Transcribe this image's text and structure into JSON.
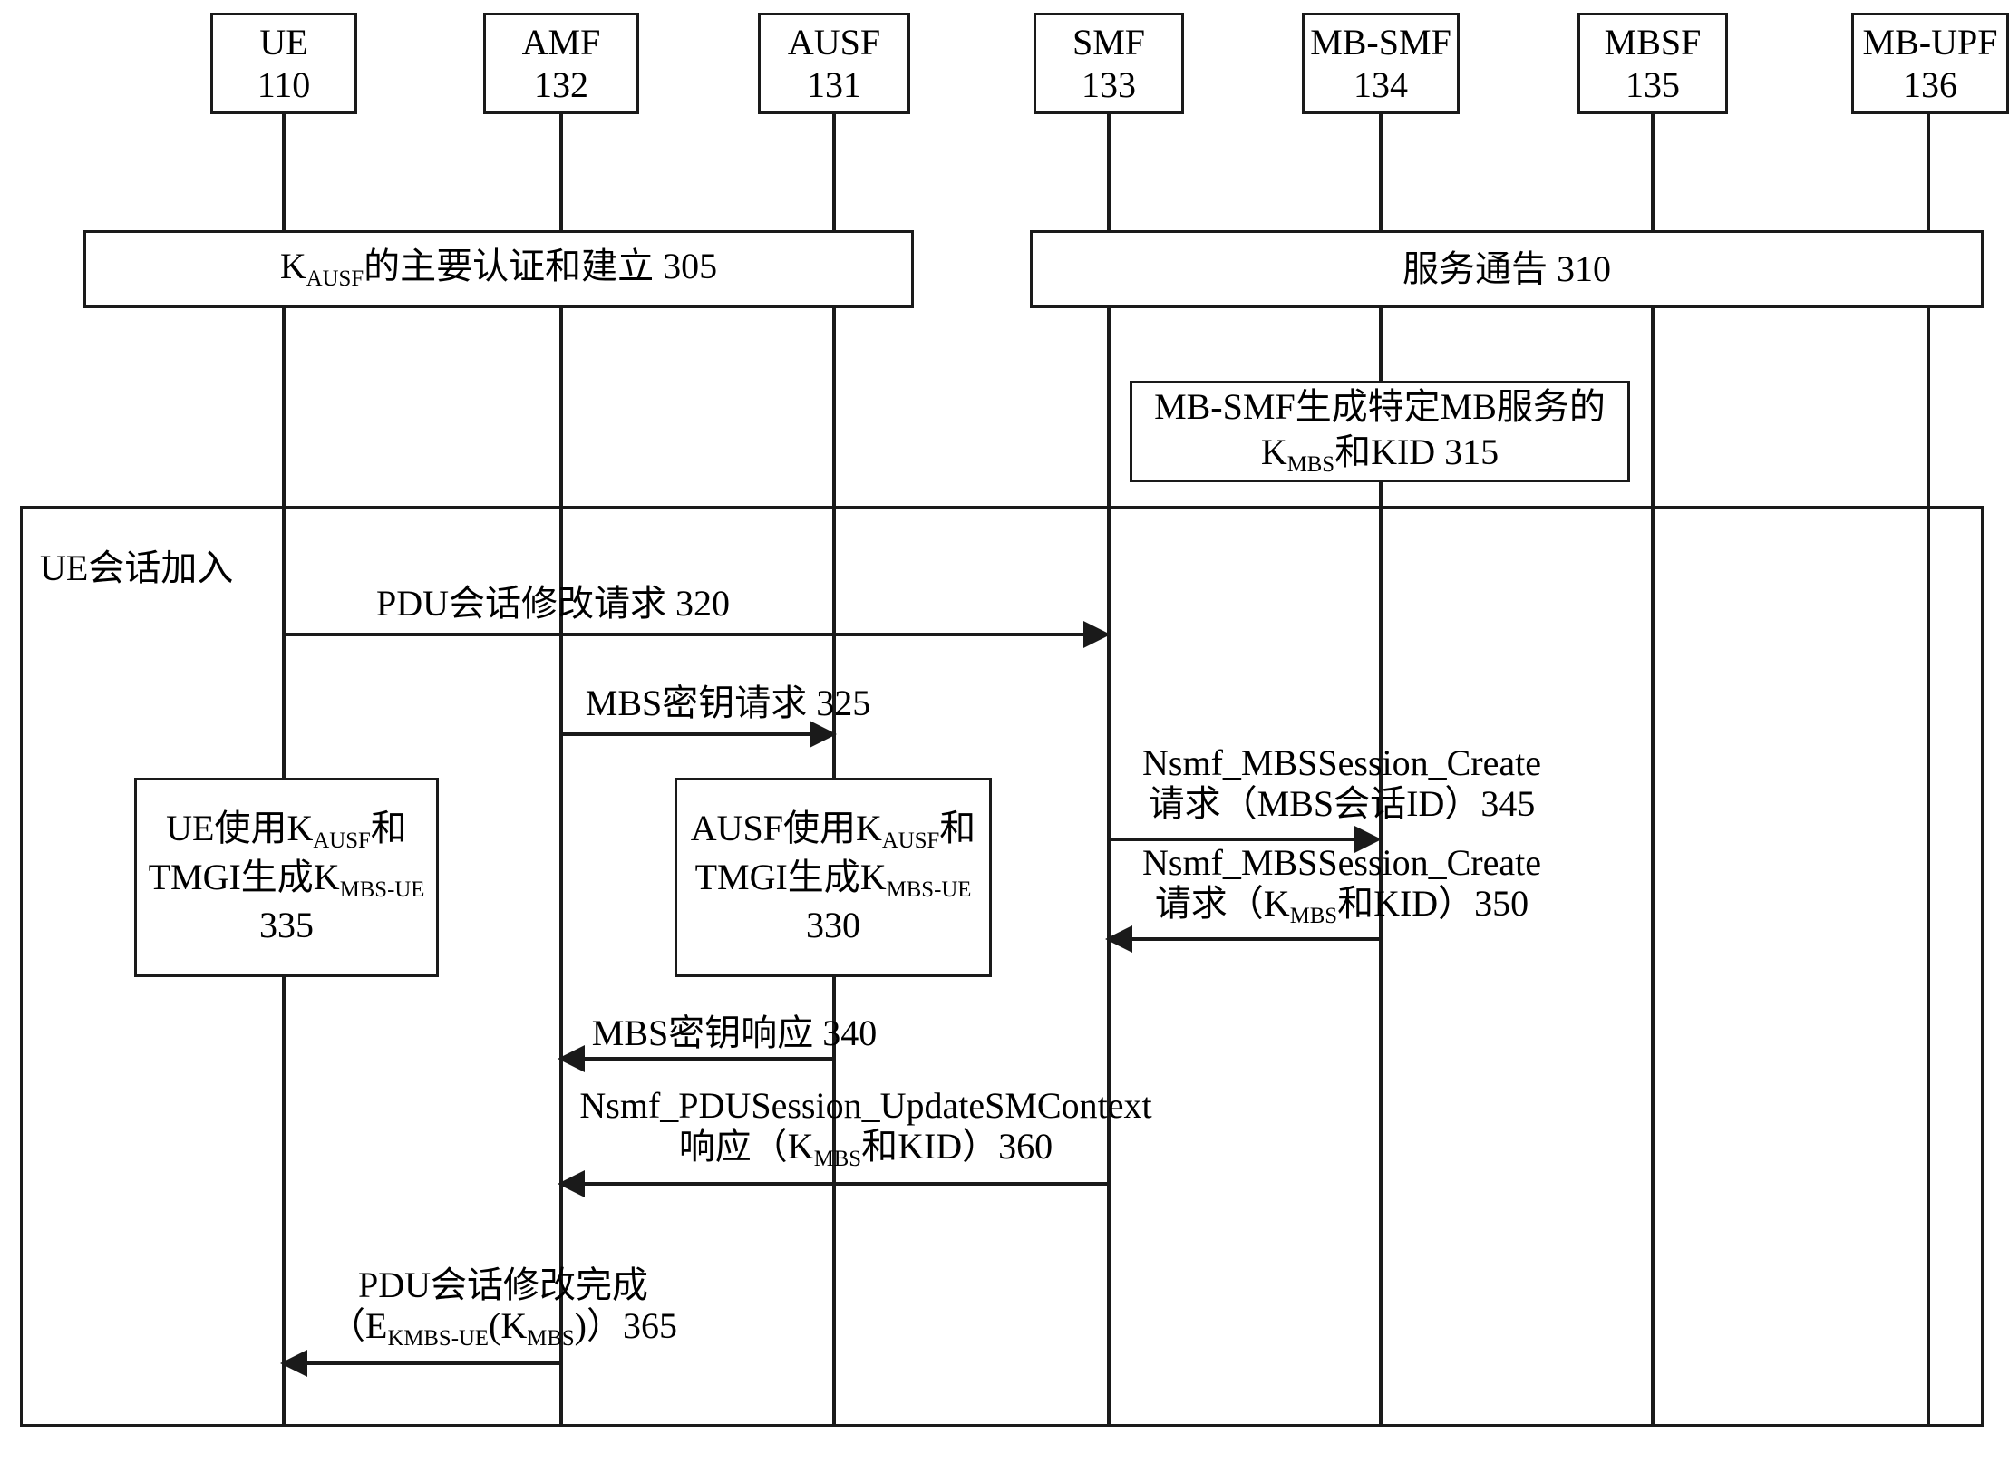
{
  "diagram": {
    "title": "MBS key distribution call flow",
    "actors": [
      {
        "name": "UE",
        "number": "110"
      },
      {
        "name": "AMF",
        "number": "132"
      },
      {
        "name": "AUSF",
        "number": "131"
      },
      {
        "name": "SMF",
        "number": "133"
      },
      {
        "name": "MB-SMF",
        "number": "134"
      },
      {
        "name": "MBSF",
        "number": "135"
      },
      {
        "name": "MB-UPF",
        "number": "136"
      }
    ],
    "span_boxes": [
      {
        "id": "305",
        "text_html": "K<sub>AUSF</sub>的主要认证和建立 305",
        "plain": "K_AUSF的主要认证和建立 305"
      },
      {
        "id": "310",
        "text_html": "服务通告 310",
        "plain": "服务通告 310"
      },
      {
        "id": "315",
        "text_html": "MB-SMF生成特定MB服务的<br>K<sub>MBS</sub>和KID 315",
        "plain": "MB-SMF生成特定MB服务的 K_MBS和KID 315"
      },
      {
        "id": "335",
        "text_html": "UE使用K<sub>AUSF</sub>和<br>TMGI生成K<sub>MBS-UE</sub><br>335",
        "plain": "UE使用K_AUSF和TMGI生成K_MBS-UE 335"
      },
      {
        "id": "330",
        "text_html": "AUSF使用K<sub>AUSF</sub>和<br>TMGI生成K<sub>MBS-UE</sub><br>330",
        "plain": "AUSF使用K_AUSF和TMGI生成K_MBS-UE 330"
      }
    ],
    "frame": {
      "label": "UE会话加入"
    },
    "messages": [
      {
        "id": "320",
        "text_html": "PDU会话修改请求 320",
        "plain": "PDU会话修改请求 320",
        "direction": "right",
        "from": "UE",
        "to": "SMF"
      },
      {
        "id": "325",
        "text_html": "MBS密钥请求 325",
        "plain": "MBS密钥请求 325",
        "direction": "right",
        "from": "AMF",
        "to": "AUSF"
      },
      {
        "id": "345",
        "text_html": "Nsmf_MBSSession_Create<br>请求（MBS会话ID）345",
        "plain": "Nsmf_MBSSession_Create 请求（MBS会话ID）345",
        "direction": "right",
        "from": "SMF",
        "to": "MB-SMF"
      },
      {
        "id": "350",
        "text_html": "Nsmf_MBSSession_Create<br>请求（K<sub>MBS</sub>和KID）350",
        "plain": "Nsmf_MBSSession_Create 请求（K_MBS和KID）350",
        "direction": "left",
        "from": "MB-SMF",
        "to": "SMF"
      },
      {
        "id": "340",
        "text_html": "MBS密钥响应 340",
        "plain": "MBS密钥响应 340",
        "direction": "left",
        "from": "AUSF",
        "to": "AMF"
      },
      {
        "id": "360",
        "text_html": "Nsmf_PDUSession_UpdateSMContext<br>响应（K<sub>MBS</sub>和KID）360",
        "plain": "Nsmf_PDUSession_UpdateSMContext 响应（K_MBS和KID）360",
        "direction": "left",
        "from": "SMF",
        "to": "AMF"
      },
      {
        "id": "365",
        "text_html": "PDU会话修改完成<br>（E<sub>KMBS-UE</sub>(K<sub>MBS</sub>)）365",
        "plain": "PDU会话修改完成（E_KMBS-UE(K_MBS)）365",
        "direction": "left",
        "from": "AMF",
        "to": "UE"
      }
    ],
    "colors": {
      "stroke": "#1a1a1a",
      "background": "#ffffff"
    }
  }
}
